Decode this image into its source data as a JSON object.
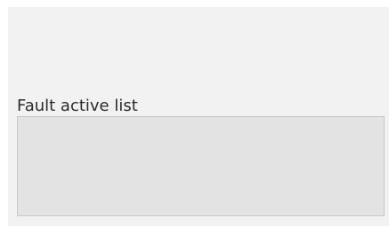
{
  "fault_panel": {
    "label": "Fault active list",
    "items": []
  },
  "colors": {
    "panel_background": "#f2f2f2",
    "listbox_background": "#e3e3e3",
    "listbox_border": "#c9c9c9",
    "label_text": "#2b2b2b"
  }
}
